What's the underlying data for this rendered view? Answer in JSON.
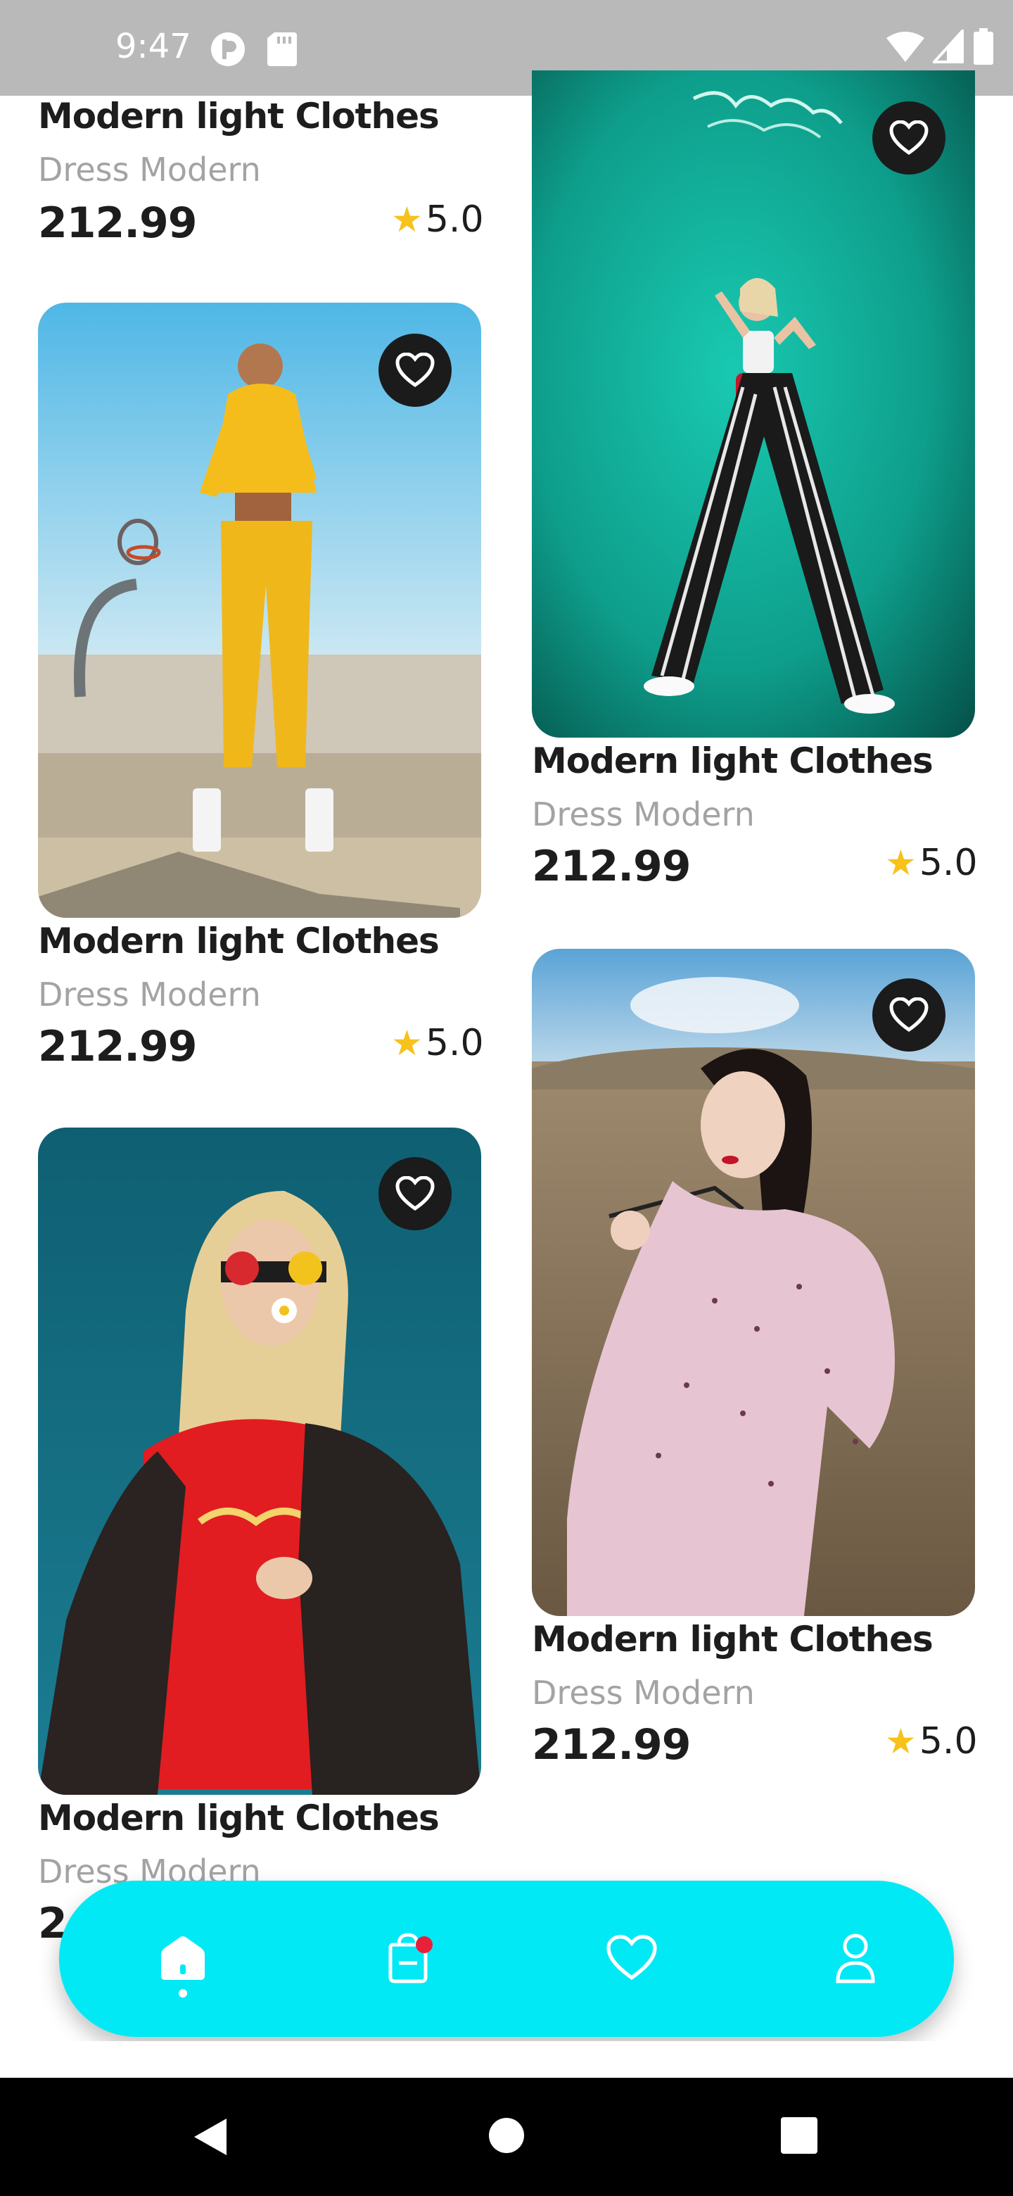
{
  "status_bar": {
    "time": "9:47",
    "icons": [
      "media-icon",
      "sd-card-icon",
      "wifi-icon",
      "signal-icon",
      "battery-icon"
    ]
  },
  "products": [
    {
      "title": "Modern light Clothes",
      "subtitle": "Dress Modern",
      "price": "212.99",
      "rating": "5.0",
      "image": "woman in yellow tracksuit by basketball hoop"
    },
    {
      "title": "Modern light Clothes",
      "subtitle": "Dress Modern",
      "price": "212.99",
      "rating": "5.0",
      "image": "woman in striped trousers against teal neon wall"
    },
    {
      "title": "Modern light Clothes",
      "subtitle": "Dress Modern",
      "price": "212.99",
      "rating": "5.0",
      "image": "woman in yellow tracksuit"
    },
    {
      "title": "Modern light Clothes",
      "subtitle": "Dress Modern",
      "price": "212.99",
      "rating": "5.0",
      "image": "woman in pink puff dress in field"
    },
    {
      "title": "Modern light Clothes",
      "subtitle": "Dress Modern",
      "price": "2",
      "rating": "",
      "image": "blonde woman in red shirt and sunglasses"
    }
  ],
  "bottom_nav": {
    "items": [
      "home-icon",
      "bag-icon",
      "heart-icon",
      "profile-icon"
    ],
    "active": "home-icon",
    "accent": "#00e9f5",
    "badge_color": "#e8203a"
  },
  "colors": {
    "star": "#f6c21b",
    "price": "#1d1d1d",
    "subtitle": "#a3a3a3"
  }
}
